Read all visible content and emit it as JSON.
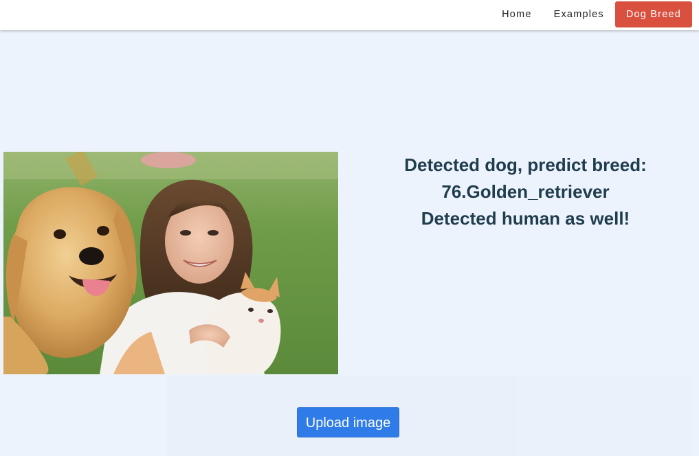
{
  "nav": {
    "items": [
      {
        "label": "Home",
        "active": false
      },
      {
        "label": "Examples",
        "active": false
      },
      {
        "label": "Dog Breed",
        "active": true
      }
    ],
    "active_color": "#d9503f"
  },
  "result": {
    "line1": "Detected dog, predict breed:",
    "line2": "76.Golden_retriever",
    "line3": "Detected human as well!"
  },
  "upload": {
    "label": "Upload image",
    "color": "#2f7ce8"
  },
  "colors": {
    "background": "#edf3fc",
    "result_text": "#1f3d4d"
  }
}
